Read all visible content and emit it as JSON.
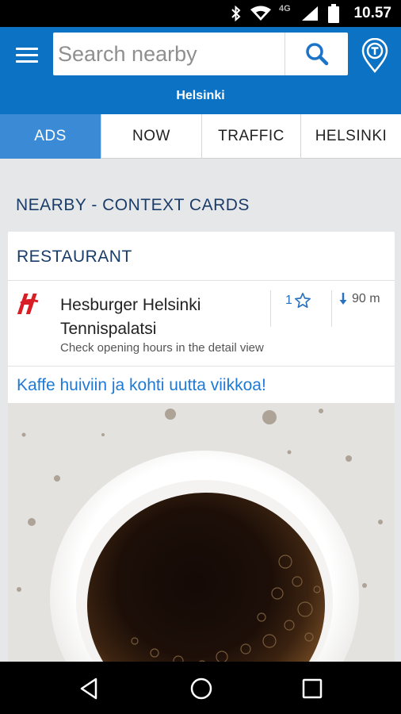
{
  "status_bar": {
    "time": "10.57",
    "network_label": "4G",
    "icons": [
      "bluetooth-icon",
      "wifi-icon",
      "signal-icon",
      "battery-icon"
    ]
  },
  "app_bar": {
    "search_placeholder": "Search nearby",
    "city": "Helsinki",
    "accent_color": "#0c72c4"
  },
  "tabs": [
    {
      "label": "ADS",
      "active": true
    },
    {
      "label": "NOW",
      "active": false
    },
    {
      "label": "TRAFFIC",
      "active": false
    },
    {
      "label": "HELSINKI",
      "active": false
    }
  ],
  "section_title": "NEARBY - CONTEXT CARDS",
  "card": {
    "category": "RESTAURANT",
    "place": {
      "name": "Hesburger Helsinki Tennispalatsi",
      "note": "Check opening hours in the detail view",
      "rating": "1",
      "distance": "90 m"
    },
    "ad_headline": "Kaffe huiviin ja kohti uutta viikkoa!",
    "ad_image": "coffee-cup-photo"
  },
  "nav_bar": {
    "icons": [
      "back-icon",
      "home-icon",
      "recents-icon"
    ]
  }
}
